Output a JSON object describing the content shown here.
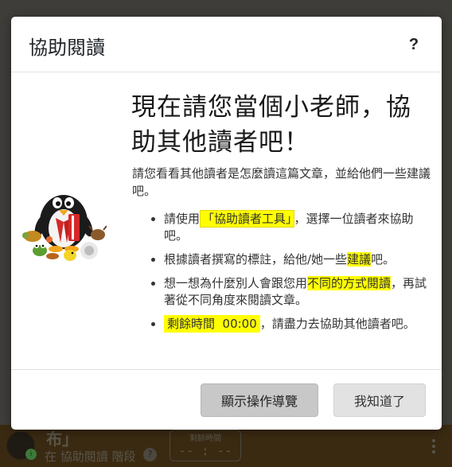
{
  "background": {
    "title": "布」",
    "subtitle": "在 協助閱讀 階段",
    "help_glyph": "?",
    "timer_label": "剩餘時間",
    "timer_value": "-- : --",
    "status_dot": "i"
  },
  "modal": {
    "title": "協助閱讀",
    "help_label": "?",
    "headline": "現在請您當個小老師，協助其他讀者吧！",
    "intro": "請您看看其他讀者是怎麼讀這篇文章，並給他們一些建議吧。",
    "steps": [
      {
        "before": "請使用",
        "highlight": "「協助讀者工具」",
        "after": "，選擇一位讀者來協助吧。"
      },
      {
        "before": "根據讀者撰寫的標註，給他/她一些",
        "highlight": "建議",
        "after": "吧。"
      },
      {
        "before": "想一想為什麼別人會跟您用",
        "highlight": "不同的方式閱讀",
        "after": "，再試著從不同角度來閱讀文章。"
      },
      {
        "highlight": "剩餘時間  00:00",
        "after": "，請盡力去協助其他讀者吧。"
      }
    ],
    "buttons": {
      "tour": "顯示操作導覽",
      "ok": "我知道了"
    }
  },
  "colors": {
    "highlight": "#ffff00",
    "penguin_scarf": "#d62828",
    "overlay": "#3f3d3a"
  },
  "icons": {
    "mascot": "penguin-mascot-with-animals",
    "help": "question-mark-icon"
  }
}
